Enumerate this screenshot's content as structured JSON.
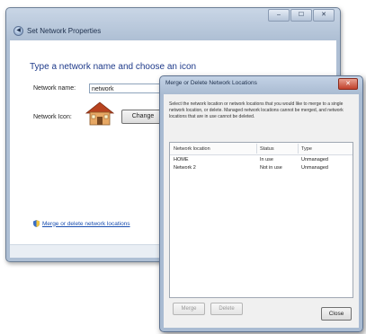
{
  "set_network_window": {
    "title": "Set Network Properties",
    "caption_buttons": [
      "–",
      "☐",
      "✕"
    ],
    "heading": "Type a network name and choose an icon",
    "network_name_label": "Network name:",
    "network_name_value": "network",
    "network_icon_label": "Network Icon:",
    "change_button": "Change",
    "merge_link": "Merge or delete network locations"
  },
  "merge_window": {
    "title": "Merge or Delete Network Locations",
    "close_glyph": "✕",
    "description": "Select the network location or network locations that you would like to merge to a single network location, or delete. Managed network locations cannot be merged, and network locations that are in use cannot be deleted.",
    "table": {
      "headers": [
        "Network location",
        "Status",
        "Type"
      ],
      "rows": [
        [
          "HOME",
          "In use",
          "Unmanaged"
        ],
        [
          "Network 2",
          "Not in use",
          "Unmanaged"
        ]
      ]
    },
    "merge_button": "Merge",
    "delete_button": "Delete",
    "close_button": "Close"
  },
  "colors": {
    "heading": "#1e3a8a",
    "link": "#1a4fb0",
    "glass_frame": "#aebfd4",
    "close_red": "#c0412b"
  },
  "icons": [
    "back-arrow-icon",
    "home-network-icon",
    "shield-icon"
  ]
}
